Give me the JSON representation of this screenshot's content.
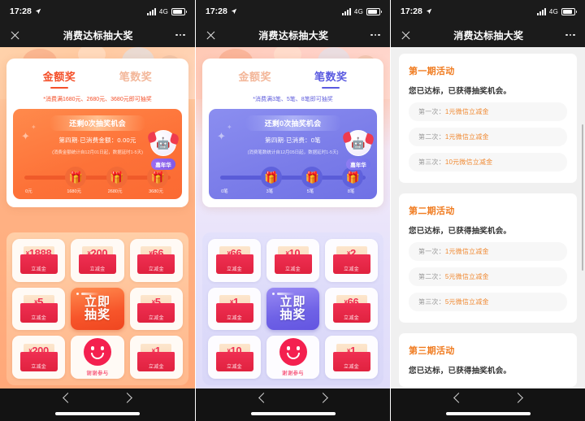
{
  "status_bar": {
    "time": "17:28",
    "network": "4G",
    "location_icon": "location-arrow-icon",
    "signal_icon": "signal-bars-icon",
    "battery_icon": "battery-icon"
  },
  "nav": {
    "title": "消费达标抽大奖",
    "close_icon": "close-icon",
    "more_icon": "more-dots-icon"
  },
  "bottom_bar": {
    "back_icon": "chevron-left-icon",
    "forward_icon": "chevron-right-icon",
    "home_indicator": "home-indicator"
  },
  "panels": [
    {
      "id": "amount-prize",
      "tabs": [
        {
          "label": "金额奖",
          "active": true
        },
        {
          "label": "笔数奖",
          "active": false
        }
      ],
      "rule": "*消费满1680元、2680元、3680元即可抽奖",
      "banner": {
        "chances": "还剩0次抽奖机会",
        "spent": "第四期·已消费金额：0.00元",
        "note": "(消费金额统计自12月01日起，数据延时1-5天)",
        "mascot_icon": "carnival-mascot-icon",
        "mascot_tag": "嘉年华",
        "milestones": [
          "0元",
          "1680元",
          "2680元",
          "3680元"
        ]
      },
      "grid": [
        {
          "type": "prize",
          "amount": "1888",
          "currency": "¥",
          "label": "立减金"
        },
        {
          "type": "prize",
          "amount": "200",
          "currency": "¥",
          "label": "立减金"
        },
        {
          "type": "prize",
          "amount": "66",
          "currency": "¥",
          "label": "立减金"
        },
        {
          "type": "prize",
          "amount": "5",
          "currency": "¥",
          "label": "立减金"
        },
        {
          "type": "draw",
          "line1": "立即",
          "line2": "抽奖"
        },
        {
          "type": "prize",
          "amount": "5",
          "currency": "¥",
          "label": "立减金"
        },
        {
          "type": "prize",
          "amount": "200",
          "currency": "¥",
          "label": "立减金"
        },
        {
          "type": "thanks",
          "label": "谢谢参与",
          "icon": "smiley-face-icon"
        },
        {
          "type": "prize",
          "amount": "1",
          "currency": "¥",
          "label": "立减金"
        }
      ]
    },
    {
      "id": "count-prize",
      "tabs": [
        {
          "label": "金额奖",
          "active": false
        },
        {
          "label": "笔数奖",
          "active": true
        }
      ],
      "rule": "*消费满3笔、5笔、8笔即可抽奖",
      "banner": {
        "chances": "还剩0次抽奖机会",
        "spent": "第四期·已消费：0笔",
        "note": "(消费笔数统计自12月05日起，数据延时1-5天)",
        "mascot_icon": "carnival-mascot-icon",
        "mascot_tag": "嘉年华",
        "milestones": [
          "0笔",
          "3笔",
          "5笔",
          "8笔"
        ]
      },
      "grid": [
        {
          "type": "prize",
          "amount": "66",
          "currency": "¥",
          "label": "立减金"
        },
        {
          "type": "prize",
          "amount": "10",
          "currency": "¥",
          "label": "立减金"
        },
        {
          "type": "prize",
          "amount": "2",
          "currency": "¥",
          "label": "立减金"
        },
        {
          "type": "prize",
          "amount": "1",
          "currency": "¥",
          "label": "立减金"
        },
        {
          "type": "draw",
          "line1": "立即",
          "line2": "抽奖"
        },
        {
          "type": "prize",
          "amount": "66",
          "currency": "¥",
          "label": "立减金"
        },
        {
          "type": "prize",
          "amount": "10",
          "currency": "¥",
          "label": "立减金"
        },
        {
          "type": "thanks",
          "label": "谢谢参与",
          "icon": "smiley-face-icon"
        },
        {
          "type": "prize",
          "amount": "1",
          "currency": "¥",
          "label": "立减金"
        }
      ]
    },
    {
      "id": "records",
      "cards": [
        {
          "title": "第一期活动",
          "status": "您已达标，已获得抽奖机会。",
          "items": [
            {
              "seq": "第一次：",
              "value": "1元微信立减金"
            },
            {
              "seq": "第二次：",
              "value": "1元微信立减金"
            },
            {
              "seq": "第三次：",
              "value": "10元微信立减金"
            }
          ]
        },
        {
          "title": "第二期活动",
          "status": "您已达标，已获得抽奖机会。",
          "items": [
            {
              "seq": "第一次：",
              "value": "1元微信立减金"
            },
            {
              "seq": "第二次：",
              "value": "5元微信立减金"
            },
            {
              "seq": "第三次：",
              "value": "5元微信立减金"
            }
          ]
        },
        {
          "title": "第三期活动",
          "status": "您已达标，已获得抽奖机会。",
          "items": []
        }
      ]
    }
  ],
  "colors": {
    "gold_accent": "#f4502a",
    "count_accent": "#5a5ae0",
    "record_title": "#f07c21",
    "record_value": "#f08a33",
    "envelope_red": "#ef2f52"
  }
}
